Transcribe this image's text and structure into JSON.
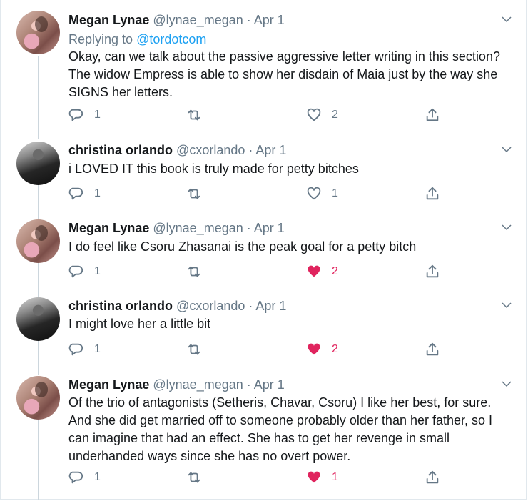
{
  "tweets": [
    {
      "name": "Megan Lynae",
      "handle": "@lynae_megan",
      "date": "Apr 1",
      "reply_prefix": "Replying to ",
      "reply_to": "@tordotcom",
      "text": "Okay, can we talk about the passive aggressive letter writing in this section? The widow Empress is able to show her disdain of Maia just by the way she SIGNS her letters.",
      "replies": "1",
      "retweets": "",
      "likes": "2",
      "liked": false
    },
    {
      "name": "christina orlando",
      "handle": "@cxorlando",
      "date": "Apr 1",
      "text": "i LOVED IT this book is truly made for petty bitches",
      "replies": "1",
      "retweets": "",
      "likes": "1",
      "liked": false
    },
    {
      "name": "Megan Lynae",
      "handle": "@lynae_megan",
      "date": "Apr 1",
      "text": "I do feel like Csoru Zhasanai is the peak goal for a petty bitch",
      "replies": "1",
      "retweets": "",
      "likes": "2",
      "liked": true
    },
    {
      "name": "christina orlando",
      "handle": "@cxorlando",
      "date": "Apr 1",
      "text": "I might love her a little bit",
      "replies": "1",
      "retweets": "",
      "likes": "2",
      "liked": true
    },
    {
      "name": "Megan Lynae",
      "handle": "@lynae_megan",
      "date": "Apr 1",
      "text": "Of the trio of antagonists (Setheris, Chavar, Csoru) I like her best, for sure. And she did get married off to someone probably older than her father, so I can imagine that had an effect. She has to get her revenge in small underhanded ways since she has no overt power.",
      "replies": "1",
      "retweets": "",
      "likes": "1",
      "liked": true
    }
  ],
  "icons": {
    "reply": "reply-icon",
    "retweet": "retweet-icon",
    "like": "heart-icon",
    "share": "share-icon",
    "menu": "chevron-down-icon"
  },
  "colors": {
    "link": "#1da1f2",
    "like_active": "#e0245e",
    "muted": "#657786"
  }
}
